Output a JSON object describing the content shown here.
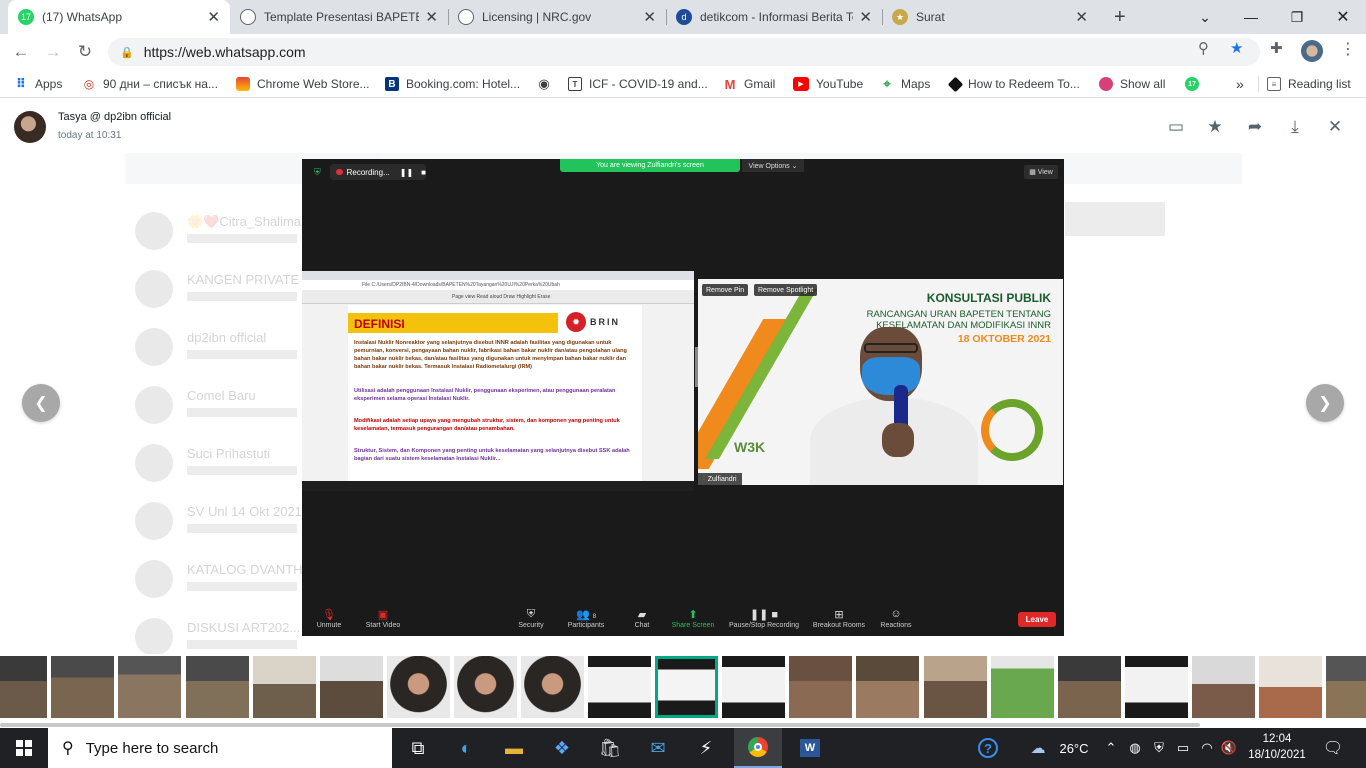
{
  "browser": {
    "tabs": [
      {
        "title": "(17) WhatsApp",
        "badge": "17",
        "icon": "whatsapp-icon",
        "color": "#25d366",
        "active": true
      },
      {
        "title": "Template Presentasi BAPETEN",
        "icon": "globe-icon",
        "color": "#5f6368"
      },
      {
        "title": "Licensing | NRC.gov",
        "icon": "globe-icon",
        "color": "#5f6368"
      },
      {
        "title": "detikcom - Informasi Berita Terkini",
        "icon": "detik-icon",
        "color": "#1e4c9a"
      },
      {
        "title": "Surat",
        "icon": "emblem-icon",
        "color": "#8c6d2b"
      }
    ],
    "new_tab": "+",
    "url": "https://web.whatsapp.com",
    "bookmarks": [
      {
        "label": "Apps",
        "icon": "apps-grid-icon"
      },
      {
        "label": "90 дни – списък на...",
        "icon": "target-icon"
      },
      {
        "label": "Chrome Web Store...",
        "icon": "chrome-webstore-icon"
      },
      {
        "label": "Booking.com: Hotel...",
        "icon": "booking-icon"
      },
      {
        "label": "",
        "icon": "globe-icon"
      },
      {
        "label": "ICF - COVID-19 and...",
        "icon": "bracket-icon"
      },
      {
        "label": "Gmail",
        "icon": "gmail-icon"
      },
      {
        "label": "YouTube",
        "icon": "youtube-icon"
      },
      {
        "label": "Maps",
        "icon": "maps-pin-icon"
      },
      {
        "label": "How to Redeem To...",
        "icon": "redeem-icon"
      },
      {
        "label": "Show all",
        "icon": "show-all-icon"
      },
      {
        "label": "",
        "icon": "whatsapp-badge-icon"
      }
    ],
    "overflow": "»",
    "reading_list": "Reading list"
  },
  "viewer": {
    "sender": "Tasya @ dp2ibn official",
    "timestamp": "today at 10:31",
    "background_chats": [
      "🌼❤️Citra_Shalima",
      "KANGEN PRIVATE",
      "dp2ibn official",
      "Comel Baru",
      "Suci Prihastuti",
      "SV Unl 14 Okt 2021",
      "KATALOG DVANTH",
      "DISKUSI ART202..."
    ]
  },
  "zoom": {
    "recording_label": "Recording...",
    "viewing_label": "You are viewing Zulfiandri's screen",
    "view_options": "View Options ⌄",
    "view_label": "View",
    "address_text": "File  C:/Users/DP2IBN-4/Downloads/BAPETEN%20Tayangan%20UJI%20Perka%20Ubah",
    "pdf_toolbar": "Page view    Read aloud    Draw    Highlight    Erase",
    "slide": {
      "heading": "DEFINISI",
      "logo": "BRIN",
      "p1": "Instalasi Nuklir Nonreaktor yang selanjutnya disebut INNR adalah fasilitas yang digunakan untuk pemurnian, konversi, pengayaan bahan nuklir, fabrikasi bahan bakar nuklir dan/atau pengolahan ulang bahan bakar nuklir bekas, dan/atau fasilitas yang digunakan untuk menyimpan bahan bakar nuklir dan bahan bakar nuklir bekas. Termasuk Instalasi Radiometalurgi (IRM)",
      "p2": "Utilisasi adalah penggunaan Instalasi Nuklir, penggunaan eksperimen, atau penggunaan peralatan eksperimen selama operasi Instalasi Nuklir.",
      "p3": "Modifikasi adalah setiap upaya yang mengubah struktur, sistem, dan komponen yang penting untuk keselamatan, termasuk pengurangan dan/atau penambahan.",
      "p4": "Struktur, Sistem, dan Komponen yang penting untuk keselamatan yang selanjutnya disebut SSK adalah bagian dari suatu sistem keselamatan Instalasi Nuklir..."
    },
    "speaker": {
      "title": "KONSULTASI PUBLIK",
      "line1": "RANCANGAN     URAN BAPETEN TENTANG",
      "line2": "KESELAMATAN          DAN MODIFIKASI INNR",
      "date": "18 OKTOBER 2021",
      "name": "Zulfiandri",
      "remove_pin": "Remove Pin",
      "remove_spotlight": "Remove Spotlight",
      "watermark": "W3K"
    },
    "toolbar": [
      {
        "label": "Unmute",
        "icon": "mic-muted-icon"
      },
      {
        "label": "Start Video",
        "icon": "video-off-icon"
      },
      {
        "label": "Security",
        "icon": "shield-icon"
      },
      {
        "label": "Participants",
        "icon": "participants-icon",
        "count": "8"
      },
      {
        "label": "Chat",
        "icon": "chat-icon"
      },
      {
        "label": "Share Screen",
        "icon": "share-screen-icon"
      },
      {
        "label": "Pause/Stop Recording",
        "icon": "recording-icon"
      },
      {
        "label": "Breakout Rooms",
        "icon": "breakout-icon"
      },
      {
        "label": "Reactions",
        "icon": "reactions-icon"
      }
    ],
    "leave": "Leave"
  },
  "taskbar": {
    "search_placeholder": "Type here to search",
    "temperature": "26°C",
    "time": "12:04",
    "date": "18/10/2021"
  },
  "colors": {
    "whatsapp_green": "#00a884",
    "zoom_green": "#23c35b",
    "zoom_leave": "#e02828",
    "taskbar": "#1f2124"
  }
}
